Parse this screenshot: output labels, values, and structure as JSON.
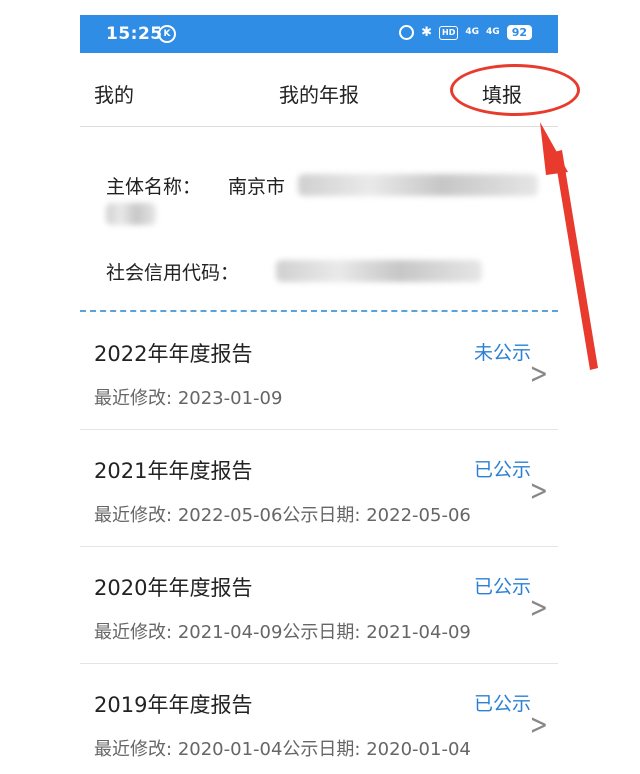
{
  "status_bar": {
    "time": "15:25",
    "k_label": "K",
    "hd_label": "HD",
    "signal1": "4G",
    "signal2": "4G",
    "battery": "92"
  },
  "nav": {
    "back_label": "我的",
    "title": "我的年报",
    "action_label": "填报"
  },
  "entity": {
    "name_label": "主体名称：",
    "name_value": "南京市",
    "credit_label": "社会信用代码："
  },
  "reports": [
    {
      "title": "2022年年度报告",
      "status": "未公示",
      "modified_label": "最近修改:",
      "modified": "2023-01-09",
      "published_label": "",
      "published": ""
    },
    {
      "title": "2021年年度报告",
      "status": "已公示",
      "modified_label": "最近修改:",
      "modified": "2022-05-06",
      "published_label": "公示日期:",
      "published": "2022-05-06"
    },
    {
      "title": "2020年年度报告",
      "status": "已公示",
      "modified_label": "最近修改:",
      "modified": "2021-04-09",
      "published_label": "公示日期:",
      "published": "2021-04-09"
    },
    {
      "title": "2019年年度报告",
      "status": "已公示",
      "modified_label": "最近修改:",
      "modified": "2020-01-04",
      "published_label": "公示日期:",
      "published": "2020-01-04"
    }
  ],
  "colors": {
    "status_bar": "#2f8de6",
    "status_text": "#2b80d6",
    "annotation": "#e83a2d",
    "divider_dashed": "#59a3dc"
  },
  "icons": {
    "chevron": "chevron-right-icon",
    "alarm": "alarm-icon",
    "bluetooth": "bluetooth-icon",
    "battery": "battery-icon"
  }
}
